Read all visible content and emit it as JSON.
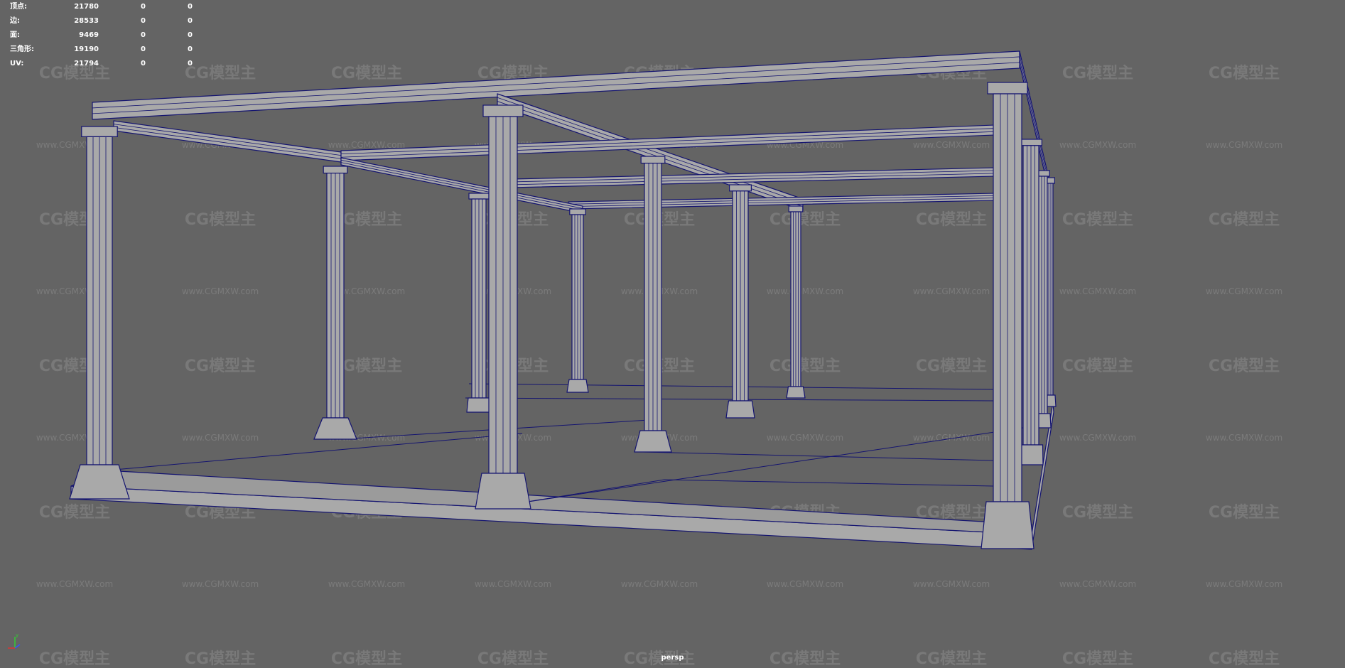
{
  "hud": {
    "rows": [
      {
        "label": "顶点:",
        "value": "21780",
        "sel": "0",
        "tri": "0"
      },
      {
        "label": "边:",
        "value": "28533",
        "sel": "0",
        "tri": "0"
      },
      {
        "label": "面:",
        "value": "9469",
        "sel": "0",
        "tri": "0"
      },
      {
        "label": "三角形:",
        "value": "19190",
        "sel": "0",
        "tri": "0"
      },
      {
        "label": "UV:",
        "value": "21794",
        "sel": "0",
        "tri": "0"
      }
    ]
  },
  "watermark": {
    "logo_text": "CG模型主",
    "url_text": "www.CGMXW.com"
  },
  "camera_label": "persp",
  "axis": {
    "y": "y"
  },
  "colors": {
    "background": "#646464",
    "mesh_fill": "#a9a9a9",
    "wire": "#141470",
    "hud_text": "#ffffff"
  }
}
